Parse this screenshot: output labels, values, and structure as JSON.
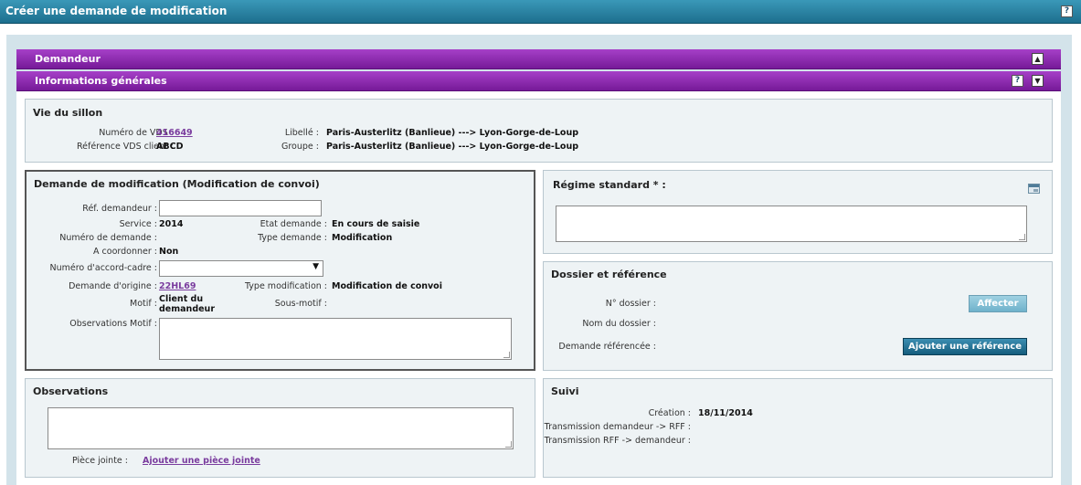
{
  "window": {
    "title": "Créer une demande de modification",
    "help": "?"
  },
  "sections": {
    "demandeur": "Demandeur",
    "informations": "Informations générales",
    "help": "?",
    "collapse_up": "▲",
    "collapse_down": "▼"
  },
  "vie_sillon": {
    "title": "Vie du sillon",
    "num_vds_label": "Numéro de VDS :",
    "num_vds_value": "416649",
    "ref_client_label": "Référence VDS client :",
    "ref_client_value": "ABCD",
    "libelle_label": "Libellé :",
    "libelle_value": "Paris-Austerlitz (Banlieue) ---> Lyon-Gorge-de-Loup",
    "groupe_label": "Groupe :",
    "groupe_value": "Paris-Austerlitz (Banlieue) ---> Lyon-Gorge-de-Loup"
  },
  "demande": {
    "title": "Demande de modification (Modification de convoi)",
    "ref_demandeur_label": "Réf. demandeur :",
    "ref_demandeur_value": "",
    "service_label": "Service :",
    "service_value": "2014",
    "etat_label": "Etat demande :",
    "etat_value": "En cours de saisie",
    "numero_label": "Numéro de demande :",
    "type_demande_label": "Type demande :",
    "type_demande_value": "Modification",
    "coordonner_label": "A coordonner :",
    "coordonner_value": "Non",
    "accord_label": "Numéro d'accord-cadre :",
    "accord_value": "",
    "origine_label": "Demande d'origine :",
    "origine_value": "22HL69",
    "type_modif_label": "Type modification :",
    "type_modif_value": "Modification de convoi",
    "motif_label": "Motif :",
    "motif_value_1": "Client du",
    "motif_value_2": "demandeur",
    "sous_motif_label": "Sous-motif :",
    "obs_motif_label": "Observations Motif :",
    "obs_motif_value": ""
  },
  "regime": {
    "title": "Régime standard * :",
    "value": ""
  },
  "dossier": {
    "title": "Dossier et référence",
    "numero_label": "N° dossier :",
    "nom_label": "Nom du dossier :",
    "ref_label": "Demande référencée :",
    "affecter": "Affecter",
    "ajouter_ref": "Ajouter une référence"
  },
  "observations": {
    "title": "Observations",
    "value": "",
    "piece_label": "Pièce jointe :",
    "piece_link": "Ajouter une pièce jointe"
  },
  "suivi": {
    "title": "Suivi",
    "creation_label": "Création :",
    "creation_value": "18/11/2014",
    "trans1_label": "Transmission demandeur -> RFF :",
    "trans2_label": "Transmission RFF -> demandeur :"
  },
  "colors": {
    "titlebar": "#1d6f8e",
    "section_bar": "#8a2bb0",
    "link": "#7a3c9e",
    "button_dark": "#155d7d"
  }
}
